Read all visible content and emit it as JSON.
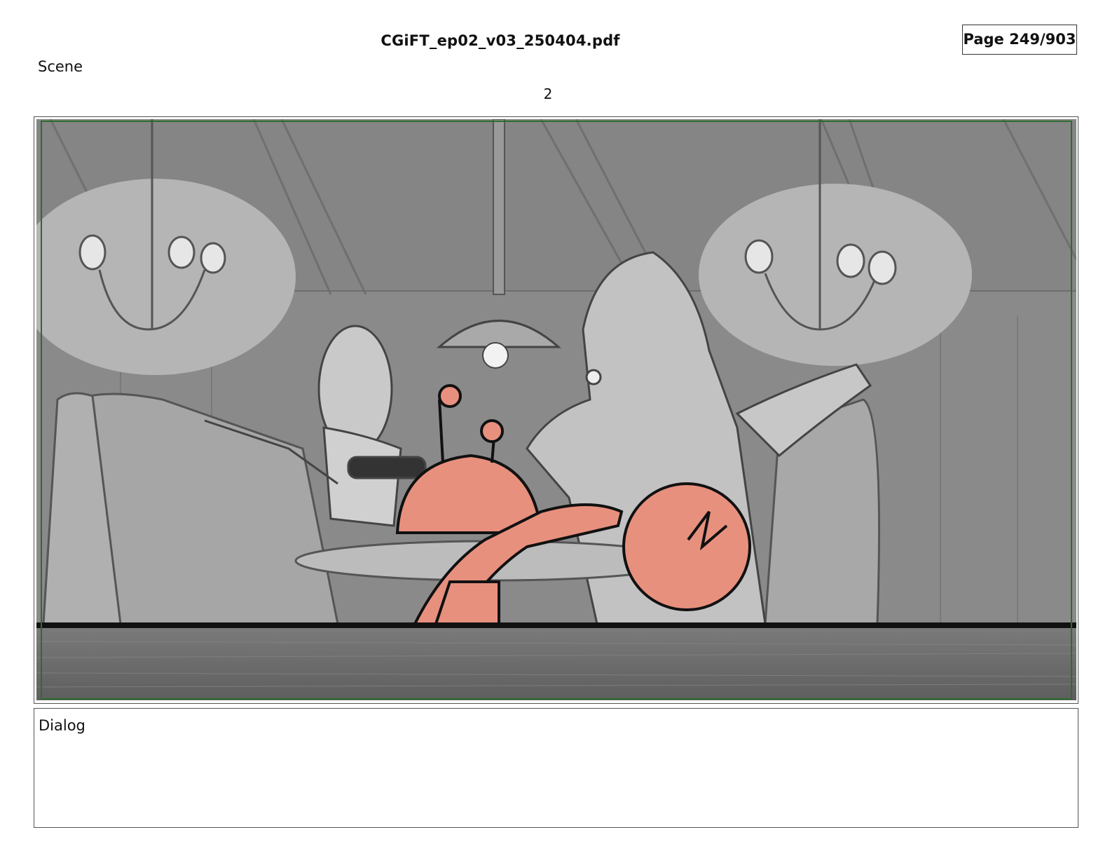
{
  "header": {
    "file_title": "CGiFT_ep02_v03_250404.pdf",
    "page_indicator": "Page 249/903"
  },
  "scene": {
    "label": "Scene",
    "number": "2"
  },
  "panel": {
    "colors": {
      "wall": "#8c8c8c",
      "light_glow": "#b8b8b8",
      "character_pink": "#e8907e",
      "table_foreground": "#6f6f6f",
      "safe_frame": "#2f6b2f"
    }
  },
  "dialog": {
    "label": "Dialog"
  }
}
